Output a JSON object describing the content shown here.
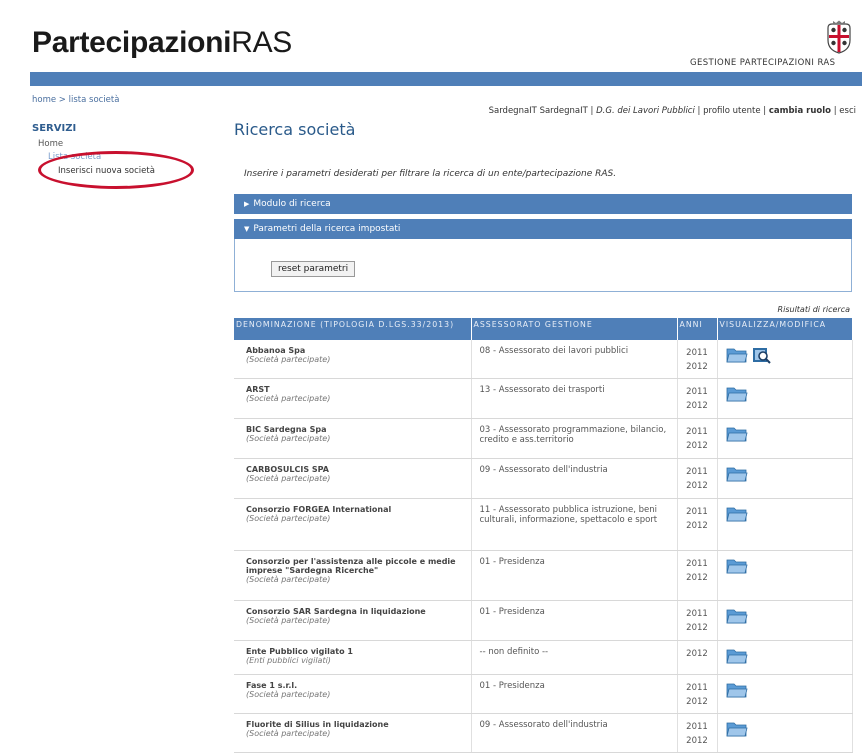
{
  "header": {
    "logo_bold": "Partecipazioni",
    "logo_light": "RAS",
    "gestione": "GESTIONE PARTECIPAZIONI RAS",
    "crest_icon": "sardinia-crest-icon"
  },
  "breadcrumb": "home > lista società",
  "userbar": {
    "user": "SardegnaIT  SardegnaIT",
    "sep1": " | ",
    "dept": "D.G. dei Lavori Pubblici",
    "sep2": " | ",
    "profile": "profilo utente",
    "sep3": " | ",
    "role": "cambia ruolo",
    "sep4": " | ",
    "exit": "esci"
  },
  "sidebar": {
    "title": "SERVIZI",
    "home": "Home",
    "lista": "Lista società",
    "inserisci": "Inserisci nuova società"
  },
  "main": {
    "title": "Ricerca società",
    "intro": "Inserire i parametri desiderati per filtrare la ricerca di un ente/partecipazione RAS.",
    "modulo_label": "Modulo di ricerca",
    "parametri_label": "Parametri della ricerca impostati",
    "reset_label": "reset parametri",
    "results_label": "Risultati di ricerca"
  },
  "table": {
    "headers": [
      "DENOMINAZIONE (TIPOLOGIA D.LGS.33/2013)",
      "ASSESSORATO GESTIONE",
      "ANNI",
      "VISUALIZZA/MODIFICA"
    ],
    "rows": [
      {
        "name": "Abbanoa Spa",
        "type": "(Società partecipate)",
        "assessorato": "08 - Assessorato dei lavori pubblici",
        "years": [
          "2011",
          "2012"
        ],
        "view": true
      },
      {
        "name": "ARST",
        "type": "(Società partecipate)",
        "assessorato": "13 - Assessorato dei trasporti",
        "years": [
          "2011",
          "2012"
        ],
        "view": false
      },
      {
        "name": "BIC Sardegna Spa",
        "type": "(Società partecipate)",
        "assessorato": "03 - Assessorato programmazione, bilancio, credito e ass.territorio",
        "years": [
          "2011",
          "2012"
        ],
        "view": false
      },
      {
        "name": "CARBOSULCIS SPA",
        "type": "(Società partecipate)",
        "assessorato": "09 - Assessorato dell'industria",
        "years": [
          "2011",
          "2012"
        ],
        "view": false
      },
      {
        "name": "Consorzio FORGEA International",
        "type": "(Società partecipate)",
        "assessorato": "11 - Assessorato pubblica istruzione, beni culturali, informazione, spettacolo e sport",
        "years": [
          "2011",
          "2012"
        ],
        "view": false
      },
      {
        "name": "Consorzio per l'assistenza alle piccole e medie imprese \"Sardegna Ricerche\"",
        "type": "(Società partecipate)",
        "assessorato": "01 - Presidenza",
        "years": [
          "2011",
          "2012"
        ],
        "view": false
      },
      {
        "name": "Consorzio SAR Sardegna in liquidazione",
        "type": "(Società partecipate)",
        "assessorato": "01 - Presidenza",
        "years": [
          "2011",
          "2012"
        ],
        "view": false
      },
      {
        "name": "Ente Pubblico vigilato 1",
        "type": "(Enti pubblici vigilati)",
        "assessorato": "-- non definito --",
        "years": [
          "2012"
        ],
        "view": false
      },
      {
        "name": "Fase 1 s.r.l.",
        "type": "(Società partecipate)",
        "assessorato": "01 - Presidenza",
        "years": [
          "2011",
          "2012"
        ],
        "view": false
      },
      {
        "name": "Fluorite di Silius in liquidazione",
        "type": "(Società partecipate)",
        "assessorato": "09 - Assessorato dell'industria",
        "years": [
          "2011",
          "2012"
        ],
        "view": false
      }
    ]
  },
  "colors": {
    "header_blue": "#4f7fb8",
    "title_blue": "#2a5a8a",
    "annotation_red": "#c8102e"
  }
}
